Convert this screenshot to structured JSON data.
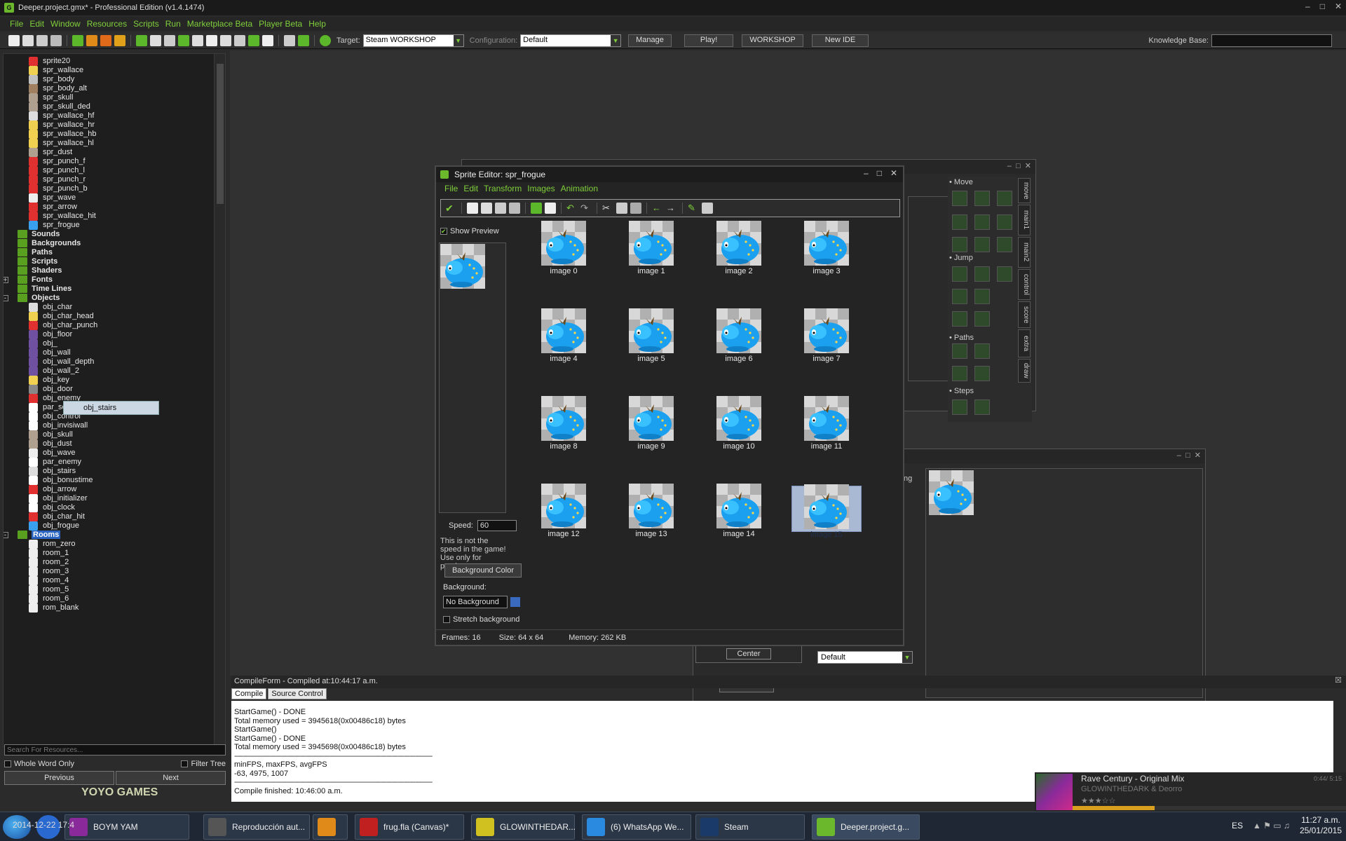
{
  "window": {
    "title": "Deeper.project.gmx* - Professional Edition (v1.4.1474)"
  },
  "menu": [
    "File",
    "Edit",
    "Window",
    "Resources",
    "Scripts",
    "Run",
    "Marketplace Beta",
    "Player Beta",
    "Help"
  ],
  "toolbar": {
    "target_label": "Target:",
    "target_value": "Steam WORKSHOP",
    "config_label": "Configuration:",
    "config_value": "Default",
    "manage": "Manage",
    "play": "Play!",
    "workshop": "WORKSHOP",
    "new_ide": "New IDE",
    "kb_label": "Knowledge Base:"
  },
  "tree": {
    "sprites": [
      "sprite20",
      "spr_wallace",
      "spr_body",
      "spr_body_alt",
      "spr_skull",
      "spr_skull_ded",
      "spr_wallace_hf",
      "spr_wallace_hr",
      "spr_wallace_hb",
      "spr_wallace_hl",
      "spr_dust",
      "spr_punch_f",
      "spr_punch_l",
      "spr_punch_r",
      "spr_punch_b",
      "spr_wave",
      "spr_arrow",
      "spr_wallace_hit",
      "spr_frogue"
    ],
    "folders": [
      "Sounds",
      "Backgrounds",
      "Paths",
      "Scripts",
      "Shaders",
      "Fonts",
      "Time Lines",
      "Objects"
    ],
    "objects": [
      "obj_char",
      "obj_char_head",
      "obj_char_punch",
      "obj_floor",
      "obj_",
      "obj_wall",
      "obj_wall_depth",
      "obj_wall_2",
      "obj_key",
      "obj_door",
      "obj_enemy",
      "par_solid",
      "obj_control",
      "obj_invisiwall",
      "obj_skull",
      "obj_dust",
      "obj_wave",
      "par_enemy",
      "obj_stairs",
      "obj_bonustime",
      "obj_arrow",
      "obj_initializer",
      "obj_clock",
      "obj_char_hit",
      "obj_frogue"
    ],
    "rooms_label": "Rooms",
    "rooms": [
      "rom_zero",
      "room_1",
      "room_2",
      "room_3",
      "room_4",
      "room_5",
      "room_6",
      "rom_blank"
    ],
    "drag_tooltip": "obj_stairs",
    "search_placeholder": "Search For Resources...",
    "whole_word": "Whole Word Only",
    "filter_tree": "Filter Tree",
    "previous": "Previous",
    "next": "Next",
    "logo": "YOYO GAMES"
  },
  "sprite_editor": {
    "title": "Sprite Editor: spr_frogue",
    "menu": [
      "File",
      "Edit",
      "Transform",
      "Images",
      "Animation"
    ],
    "show_preview": "Show Preview",
    "speed_label": "Speed:",
    "speed_value": "60",
    "speed_note": "This is not the speed in the game! Use only for preview.",
    "bg_color_button": "Background Color",
    "bg_label": "Background:",
    "bg_value": "No Background",
    "stretch": "Stretch background",
    "frames": [
      "image 0",
      "image 1",
      "image 2",
      "image 3",
      "image 4",
      "image 5",
      "image 6",
      "image 7",
      "image 8",
      "image 9",
      "image 10",
      "image 11",
      "image 12",
      "image 13",
      "image 14",
      "image 15"
    ],
    "selected_frame": "image 15",
    "status_frames": "Frames: 16",
    "status_size": "Size: 64 x 64",
    "status_memory": "Memory: 262 KB"
  },
  "object_window": {
    "action_groups": [
      "Move",
      "Jump",
      "Paths",
      "Steps"
    ],
    "tabs": [
      "move",
      "main1",
      "main2",
      "control",
      "score",
      "extra",
      "draw"
    ],
    "center": "Center",
    "ok": "OK",
    "default_select": "Default",
    "partial_label": "ng"
  },
  "compile": {
    "title": "CompileForm - Compiled at:10:44:17 a.m.",
    "tabs": [
      "Compile",
      "Source Control"
    ],
    "lines": [
      "StartGame() - DONE",
      "Total memory used = 3945618(0x00486c18) bytes",
      "StartGame()",
      "StartGame() - DONE",
      "Total memory used = 3945698(0x00486c18) bytes",
      "----------------------------------------------------------------------------------------------------------",
      "minFPS, maxFPS, avgFPS",
      "-63, 4975, 1007",
      "----------------------------------------------------------------------------------------------------------",
      "Compile finished: 10:46:00 a.m."
    ]
  },
  "music": {
    "song": "Rave Century - Original Mix",
    "artist": "GLOWINTHEDARK & Deorro",
    "time": "0:44/ 5:15",
    "progress": 0.3
  },
  "taskbar": {
    "tasks": [
      "BOYM YAM",
      "Reproducción aut...",
      "",
      "frug.fla (Canvas)*",
      "GLOWINTHEDAR...",
      "(6) WhatsApp We...",
      "Steam",
      "Deeper.project.g..."
    ],
    "overlay_date": "2014-12-22 17:4",
    "lang": "ES",
    "time": "11:27 a.m.",
    "date": "25/01/2015"
  }
}
